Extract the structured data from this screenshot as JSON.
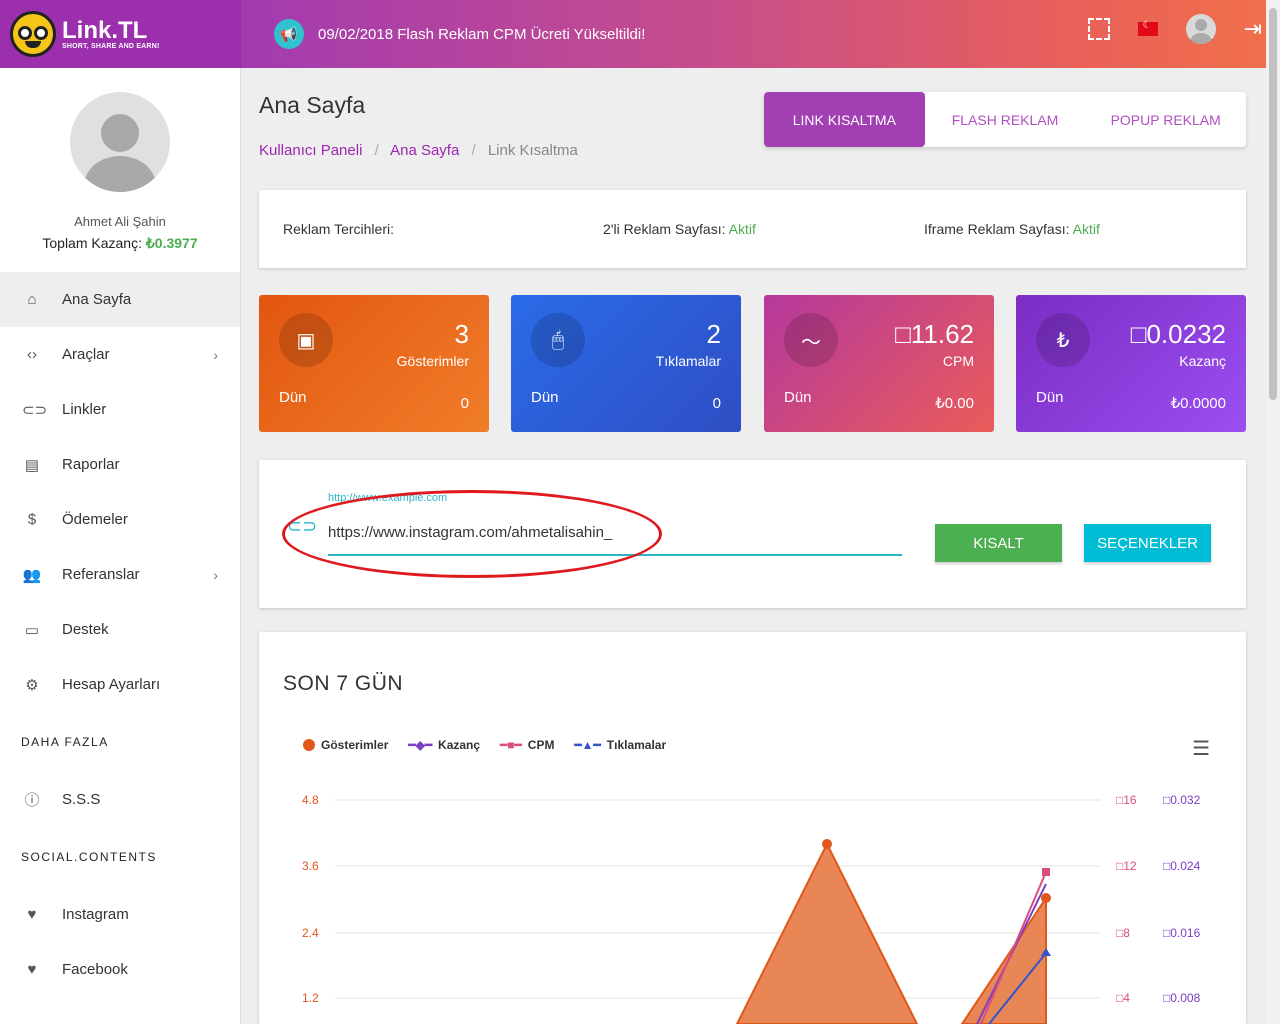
{
  "logo": {
    "brand": "Link.TL",
    "tagline": "SHORT, SHARE AND EARN!"
  },
  "header": {
    "announcement": "09/02/2018 Flash Reklam CPM Ücreti Yükseltildi!"
  },
  "profile": {
    "name": "Ahmet Ali Şahin",
    "earnings_label": "Toplam Kazanç:",
    "earnings_value": "₺0.3977"
  },
  "menu": [
    {
      "label": "Ana Sayfa",
      "icon": "home-icon",
      "active": true
    },
    {
      "label": "Araçlar",
      "icon": "code-icon"
    },
    {
      "label": "Linkler",
      "icon": "link-icon"
    },
    {
      "label": "Raporlar",
      "icon": "bar-chart-icon"
    },
    {
      "label": "Ödemeler",
      "icon": "dollar-icon"
    },
    {
      "label": "Referanslar",
      "icon": "people-icon"
    },
    {
      "label": "Destek",
      "icon": "chat-icon"
    },
    {
      "label": "Hesap Ayarları",
      "icon": "gear-icon"
    }
  ],
  "more_heading": "DAHA FAZLA",
  "more": [
    {
      "label": "S.S.S",
      "icon": "help-icon"
    }
  ],
  "social_heading": "SOCIAL.CONTENTS",
  "social": [
    {
      "label": "Instagram",
      "icon": "heart-icon"
    },
    {
      "label": "Facebook",
      "icon": "heart-icon"
    }
  ],
  "page": {
    "title": "Ana Sayfa",
    "breadcrumb": [
      "Kullanıcı Paneli",
      "Ana Sayfa",
      "Link Kısaltma"
    ]
  },
  "tabs": [
    "LINK KISALTMA",
    "FLASH REKLAM",
    "POPUP REKLAM"
  ],
  "prefs": {
    "title": "Reklam Tercihleri:",
    "two_page_label": "2'li Reklam Sayfası:",
    "two_page_value": "Aktif",
    "iframe_label": "Iframe Reklam Sayfası:",
    "iframe_value": "Aktif"
  },
  "stats": [
    {
      "value": "3",
      "label": "Gösterimler",
      "yesterday_label": "Dün",
      "yesterday_value": "0"
    },
    {
      "value": "2",
      "label": "Tıklamalar",
      "yesterday_label": "Dün",
      "yesterday_value": "0"
    },
    {
      "value": "11.62",
      "label": "CPM",
      "yesterday_label": "Dün",
      "yesterday_value": "₺0.00"
    },
    {
      "value": "0.0232",
      "label": "Kazanç",
      "yesterday_label": "Dün",
      "yesterday_value": "₺0.0000"
    }
  ],
  "shorten": {
    "placeholder": "http://www.example.com",
    "value": "https://www.instagram.com/ahmetalisahin_",
    "shorten_button": "KISALT",
    "options_button": "SEÇENEKLER"
  },
  "chart_data": {
    "type": "area",
    "title": "SON 7 GÜN",
    "legend": [
      "Gösterimler",
      "Kazanç",
      "CPM",
      "Tıklamalar"
    ],
    "y_left_ticks": [
      "4.8",
      "3.6",
      "2.4",
      "1.2"
    ],
    "y_right1_ticks": [
      "16",
      "12",
      "8",
      "4"
    ],
    "y_right2_ticks": [
      "0.032",
      "0.024",
      "0.016",
      "0.008"
    ],
    "colors": {
      "gosterimler": "#e2571b",
      "kazanc": "#7b3fc4",
      "cpm": "#d94f7a",
      "tiklamalar": "#3355cc"
    }
  }
}
